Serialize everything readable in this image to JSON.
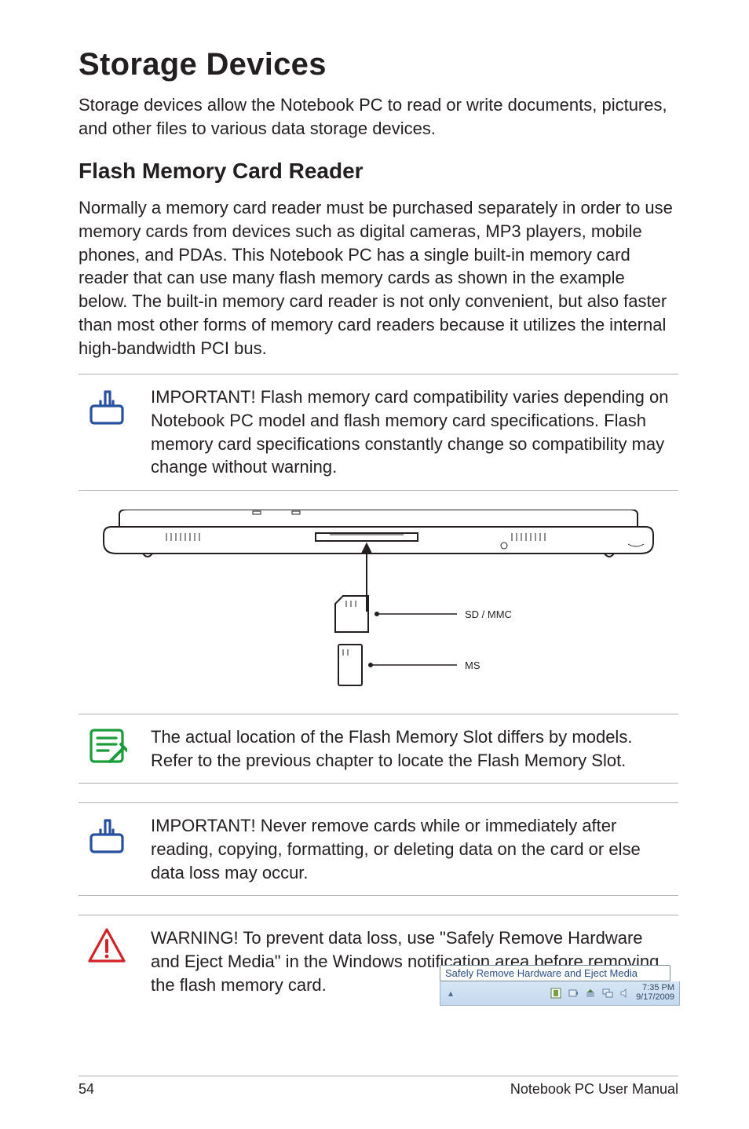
{
  "heading": "Storage Devices",
  "intro": "Storage devices allow the Notebook PC to read or write documents, pictures, and other files to various data storage devices.",
  "subheading": "Flash Memory Card Reader",
  "body": "Normally a memory card reader must be purchased separately in order to use memory cards from devices such as digital cameras, MP3 players, mobile phones, and PDAs. This Notebook PC has a single built-in memory card reader that can use many flash memory cards as shown in the example below. The built-in memory card reader is not only convenient, but also faster than most other forms of memory card readers because it utilizes the internal high-bandwidth PCI bus.",
  "callout1": "IMPORTANT! Flash memory card compatibility varies depending on Notebook PC model and flash memory card specifications. Flash memory card specifications constantly change so compatibility may change without warning.",
  "figure": {
    "label1": "SD / MMC",
    "label2": "MS"
  },
  "callout2": "The actual location of the Flash Memory Slot differs by models. Refer to the previous chapter to locate the Flash Memory Slot.",
  "callout3": "IMPORTANT!  Never remove cards while or immediately after reading, copying, formatting, or deleting data on the card or else data loss may occur.",
  "callout4": "WARNING! To prevent data loss, use \"Safely Remove Hardware and Eject Media\" in the Windows notification area before removing the flash memory card.",
  "tooltip": "Safely Remove Hardware and Eject Media",
  "tray": {
    "time": "7:35 PM",
    "date": "9/17/2009"
  },
  "footer": {
    "page": "54",
    "title": "Notebook PC User Manual"
  }
}
